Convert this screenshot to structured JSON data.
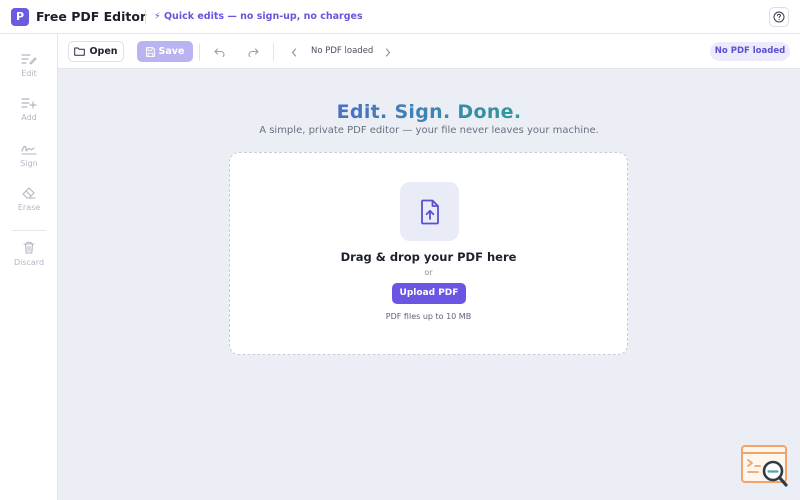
{
  "header": {
    "logo_letter": "P",
    "app_title": "Free PDF Editor",
    "tagline": "⚡ Quick edits — no sign-up, no charges",
    "help_icon": "help-circle-icon"
  },
  "sidebar": {
    "items": [
      {
        "label": "Edit",
        "icon": "edit-lines-icon"
      },
      {
        "label": "Add",
        "icon": "add-lines-icon"
      },
      {
        "label": "Sign",
        "icon": "signature-icon"
      },
      {
        "label": "Erase",
        "icon": "eraser-icon"
      },
      {
        "label": "Discard",
        "icon": "trash-icon"
      }
    ]
  },
  "toolbar": {
    "open_label": "Open",
    "save_label": "Save",
    "page_status": "No PDF loaded",
    "status_badge": "No PDF loaded"
  },
  "hero": {
    "title": "Edit. Sign. Done.",
    "subtitle": "A simple, private PDF editor — your file never leaves your machine."
  },
  "dropzone": {
    "title": "Drag & drop your PDF here",
    "or_text": "or",
    "upload_label": "Upload PDF",
    "note": "PDF files up to 10 MB"
  },
  "colors": {
    "accent": "#6a56e2",
    "title_gradient_start": "#4b6fc4",
    "title_gradient_end": "#2f9a9a",
    "background": "#eceef6"
  }
}
